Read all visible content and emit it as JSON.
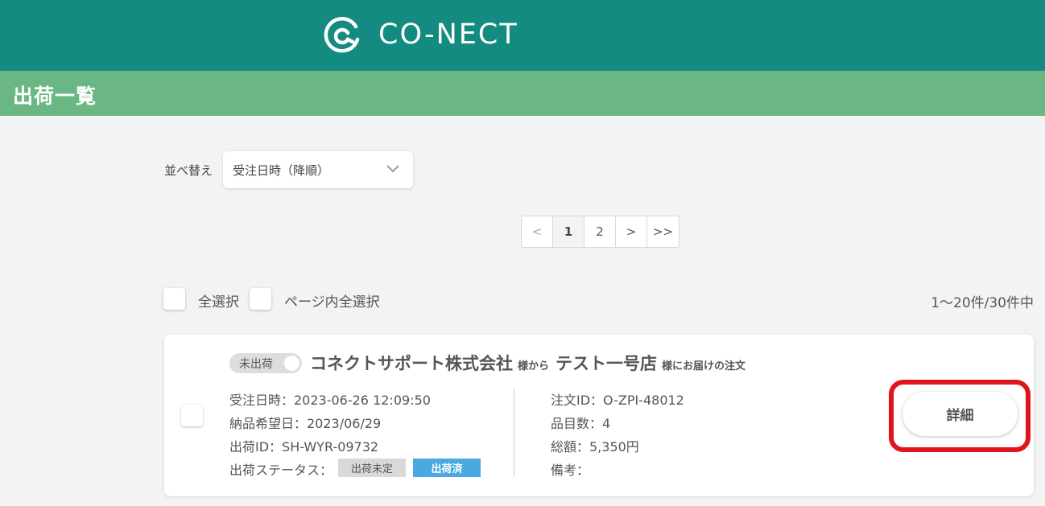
{
  "header": {
    "logo_text": "CO-NECT",
    "logo_icon": "conect-logo-icon",
    "brand_color": "#148b81"
  },
  "title_bar": {
    "title": "出荷一覧",
    "color": "#6ab783"
  },
  "sort": {
    "label": "並べ替え",
    "selected": "受注日時（降順）"
  },
  "pagination": {
    "prev": "<",
    "pages": [
      "1",
      "2"
    ],
    "current": "1",
    "next": ">",
    "last": ">>"
  },
  "selection": {
    "select_all": "全選択",
    "select_page": "ページ内全選択",
    "count": "1〜20件/30件中"
  },
  "orders": [
    {
      "status_toggle": "未出荷",
      "sender": "コネクトサポート株式会社",
      "sender_suffix": "様から",
      "recipient": "テスト一号店",
      "recipient_suffix": "様にお届けの注文",
      "order_datetime": "受注日時：2023-06-26 12:09:50",
      "delivery_date": "納品希望日：2023/06/29",
      "shipment_id": "出荷ID：SH-WYR-09732",
      "shipment_status_label": "出荷ステータス：",
      "status_unshipped": "出荷未定",
      "status_shipped": "出荷済",
      "order_id": "注文ID：O-ZPI-48012",
      "item_count": "品目数：4",
      "total": "総額：5,350円",
      "note": "備考：",
      "detail_button": "詳細"
    }
  ]
}
